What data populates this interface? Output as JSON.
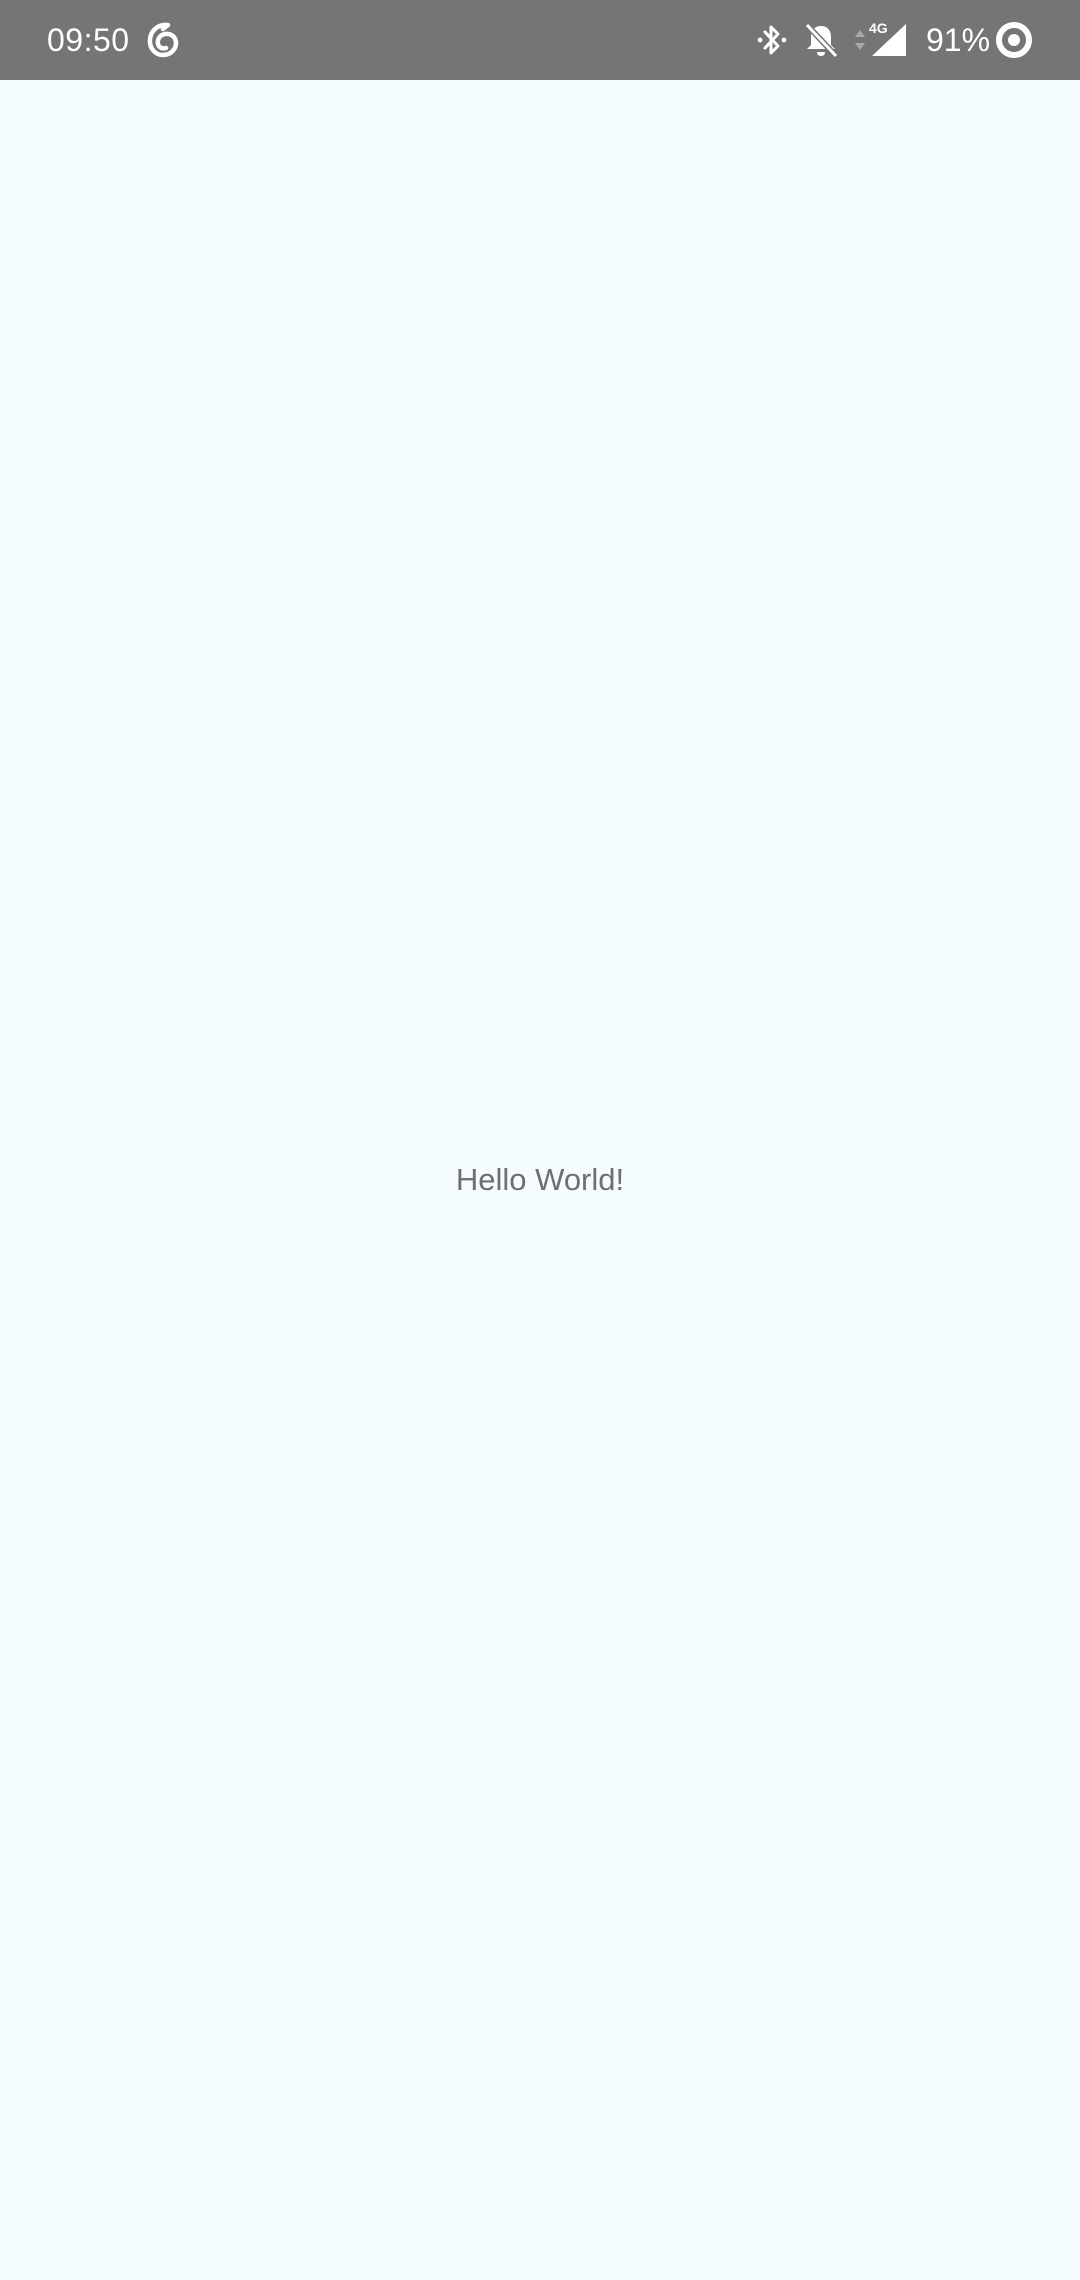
{
  "status_bar": {
    "time": "09:50",
    "network_label": "4G",
    "battery_percent": "91%",
    "icons": {
      "app_notification": "netease-music-icon",
      "bluetooth": "bluetooth-icon",
      "notifications_muted": "bell-off-icon",
      "data_activity": "data-arrows-icon",
      "signal": "cell-signal-icon",
      "battery": "battery-ring-icon"
    }
  },
  "main": {
    "text": "Hello World!"
  },
  "colors": {
    "status_bar_bg": "#757575",
    "background": "#f4fcff",
    "text": "#6f6f6f",
    "status_fg": "#ffffff"
  }
}
